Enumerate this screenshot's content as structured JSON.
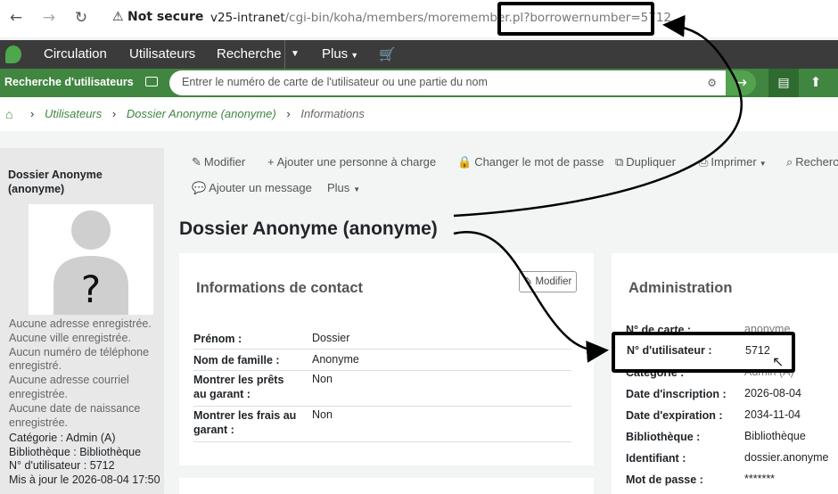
{
  "browser": {
    "security": "Not secure",
    "url_host": "v25-intranet",
    "url_path": "/cgi-bin/koha/members/moremember.pl",
    "url_query": "?borrowernumber=5712"
  },
  "mainnav": {
    "items": [
      "Circulation",
      "Utilisateurs",
      "Recherche",
      "Plus"
    ]
  },
  "searchbar": {
    "label": "Recherche d'utilisateurs",
    "placeholder": "Entrer le numéro de carte de l'utilisateur ou une partie du nom"
  },
  "breadcrumb": {
    "items": [
      "Utilisateurs",
      "Dossier Anonyme (anonyme)"
    ],
    "current": "Informations"
  },
  "sidebar": {
    "name": "Dossier Anonyme (anonyme)",
    "empty_lines": [
      "Aucune adresse enregistrée.",
      "Aucune ville enregistrée.",
      "Aucun numéro de téléphone enregistré.",
      "Aucune adresse courriel enregistrée.",
      "Aucune date de naissance enregistrée."
    ],
    "info_lines": [
      "Catégorie : Admin (A)",
      "Bibliothèque : Bibliothèque",
      "N° d'utilisateur : 5712",
      "Mis à jour le 2026-08-04 17:50"
    ]
  },
  "toolbar": {
    "edit": "Modifier",
    "add_guarantee": "Ajouter une personne à charge",
    "change_password": "Changer le mot de passe",
    "duplicate": "Dupliquer",
    "print": "Imprimer",
    "search": "Rechercher",
    "add_message": "Ajouter un message",
    "more": "Plus"
  },
  "page_title": "Dossier Anonyme (anonyme)",
  "contact": {
    "title": "Informations de contact",
    "edit_label": "Modifier",
    "rows": [
      {
        "k": "Prénom :",
        "v": "Dossier"
      },
      {
        "k": "Nom de famille :",
        "v": "Anonyme"
      },
      {
        "k": "Montrer les prêts au garant :",
        "v": "Non"
      },
      {
        "k": "Montrer les frais au garant :",
        "v": "Non"
      }
    ]
  },
  "admin": {
    "title": "Administration",
    "rows": [
      {
        "k": "N° de carte :",
        "v": "anonyme"
      },
      {
        "k": "N° d'utilisateur :",
        "v": "5712"
      },
      {
        "k": "Catégorie :",
        "v": "Admin (A)"
      },
      {
        "k": "Date d'inscription :",
        "v": "2026-08-04"
      },
      {
        "k": "Date d'expiration :",
        "v": "2034-11-04"
      },
      {
        "k": "Bibliothèque :",
        "v": "Bibliothèque"
      },
      {
        "k": "Identifiant :",
        "v": "dossier.anonyme"
      },
      {
        "k": "Mot de passe :",
        "v": "*******"
      }
    ]
  },
  "colors": {
    "green": "#408540",
    "dark_nav": "#3b3b3b",
    "link_green": "#408540"
  }
}
